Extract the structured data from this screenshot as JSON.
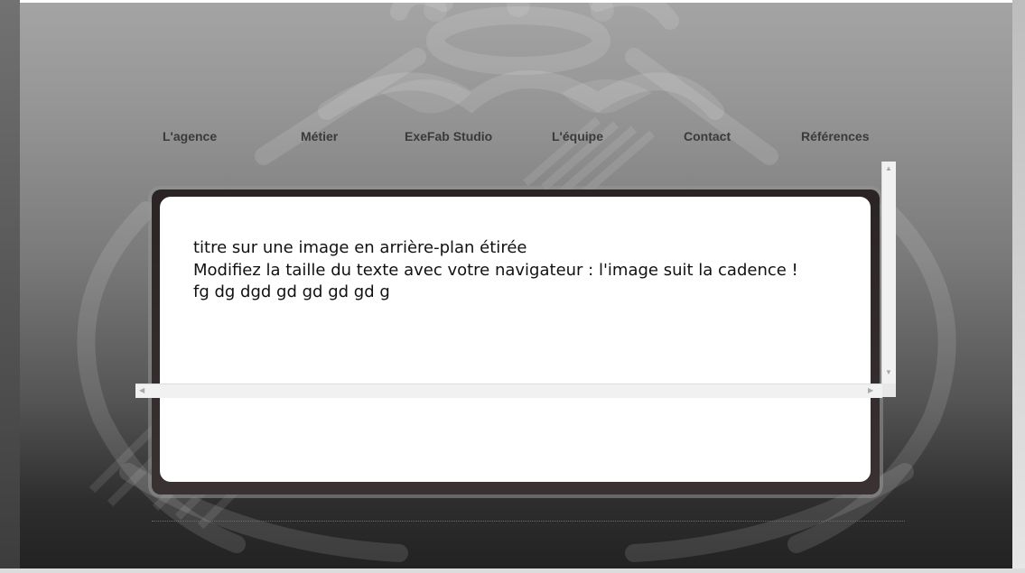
{
  "nav": {
    "items": [
      {
        "label": "L'agence"
      },
      {
        "label": "Métier"
      },
      {
        "label": "ExeFab Studio"
      },
      {
        "label": "L'équipe"
      },
      {
        "label": "Contact"
      },
      {
        "label": "Références"
      }
    ]
  },
  "content": {
    "title": "titre sur une image en arrière-plan étirée",
    "body": "Modifiez la taille du texte avec votre navigateur : l'image suit la cadence ! fg dg dgd gd gd gd gd g"
  },
  "icons": {
    "scroll_up": "scroll-up-arrow",
    "scroll_down": "scroll-down-arrow",
    "scroll_left": "scroll-left-arrow",
    "scroll_right": "scroll-right-arrow"
  },
  "colors": {
    "background_top": "#a4a4a4",
    "background_bottom": "#222222",
    "nav_text": "#3a3a3a",
    "frame": "#2b2424",
    "panel": "#ffffff",
    "body_text": "#111111"
  }
}
